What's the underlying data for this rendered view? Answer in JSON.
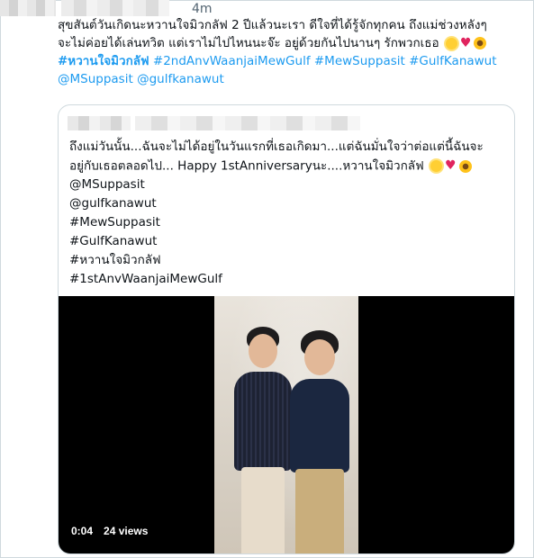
{
  "tweet": {
    "timestamp": "4m",
    "text_lines": [
      "สุขสันต์วันเกิดนะหวานใจมิวกลัฟ 2 ปีแล้วนะเรา ดีใจที่ได้รู้จักทุกคน ถึงแม่ช่วงหลังๆ",
      "จะไม่ค่อยได้เล่นทวิต แต่เราไม่ไปไหนนะจ๊ะ อยู่ด้วยกันไปนานๆ รักพวกเธอ"
    ],
    "hashtags_line": [
      "#หวานใจมิวกลัฟ",
      "#2ndAnvWaanjaiMewGulf",
      "#MewSuppasit",
      "#GulfKanawut"
    ],
    "mentions_line": [
      "@MSuppasit",
      "@gulfkanawut"
    ]
  },
  "quoted_tweet": {
    "text_lines": [
      "ถึงแม่วันนั้น...ฉันจะไม่ได้อยู่ในวันแรกที่เธอเกิดมา...แต่ฉันมั่นใจว่าต่อแต่นี้ฉันจะ",
      "อยู่กับเธอตลอดไป... Happy 1stAnniversaryนะ....หวานใจมิวกลัฟ"
    ],
    "tag_lines": [
      "@MSuppasit",
      "@gulfkanawut",
      "#MewSuppasit",
      "#GulfKanawut",
      "#หวานใจมิวกลัฟ",
      "#1stAnvWaanjaiMewGulf"
    ],
    "video": {
      "duration": "0:04",
      "views": "24 views"
    }
  },
  "colors": {
    "link": "#1d9bf0",
    "text": "#0f1419",
    "border": "#cfd9de"
  },
  "icons": [
    "sun-emoji-icon",
    "red-heart-emoji-icon",
    "sunflower-emoji-icon"
  ]
}
